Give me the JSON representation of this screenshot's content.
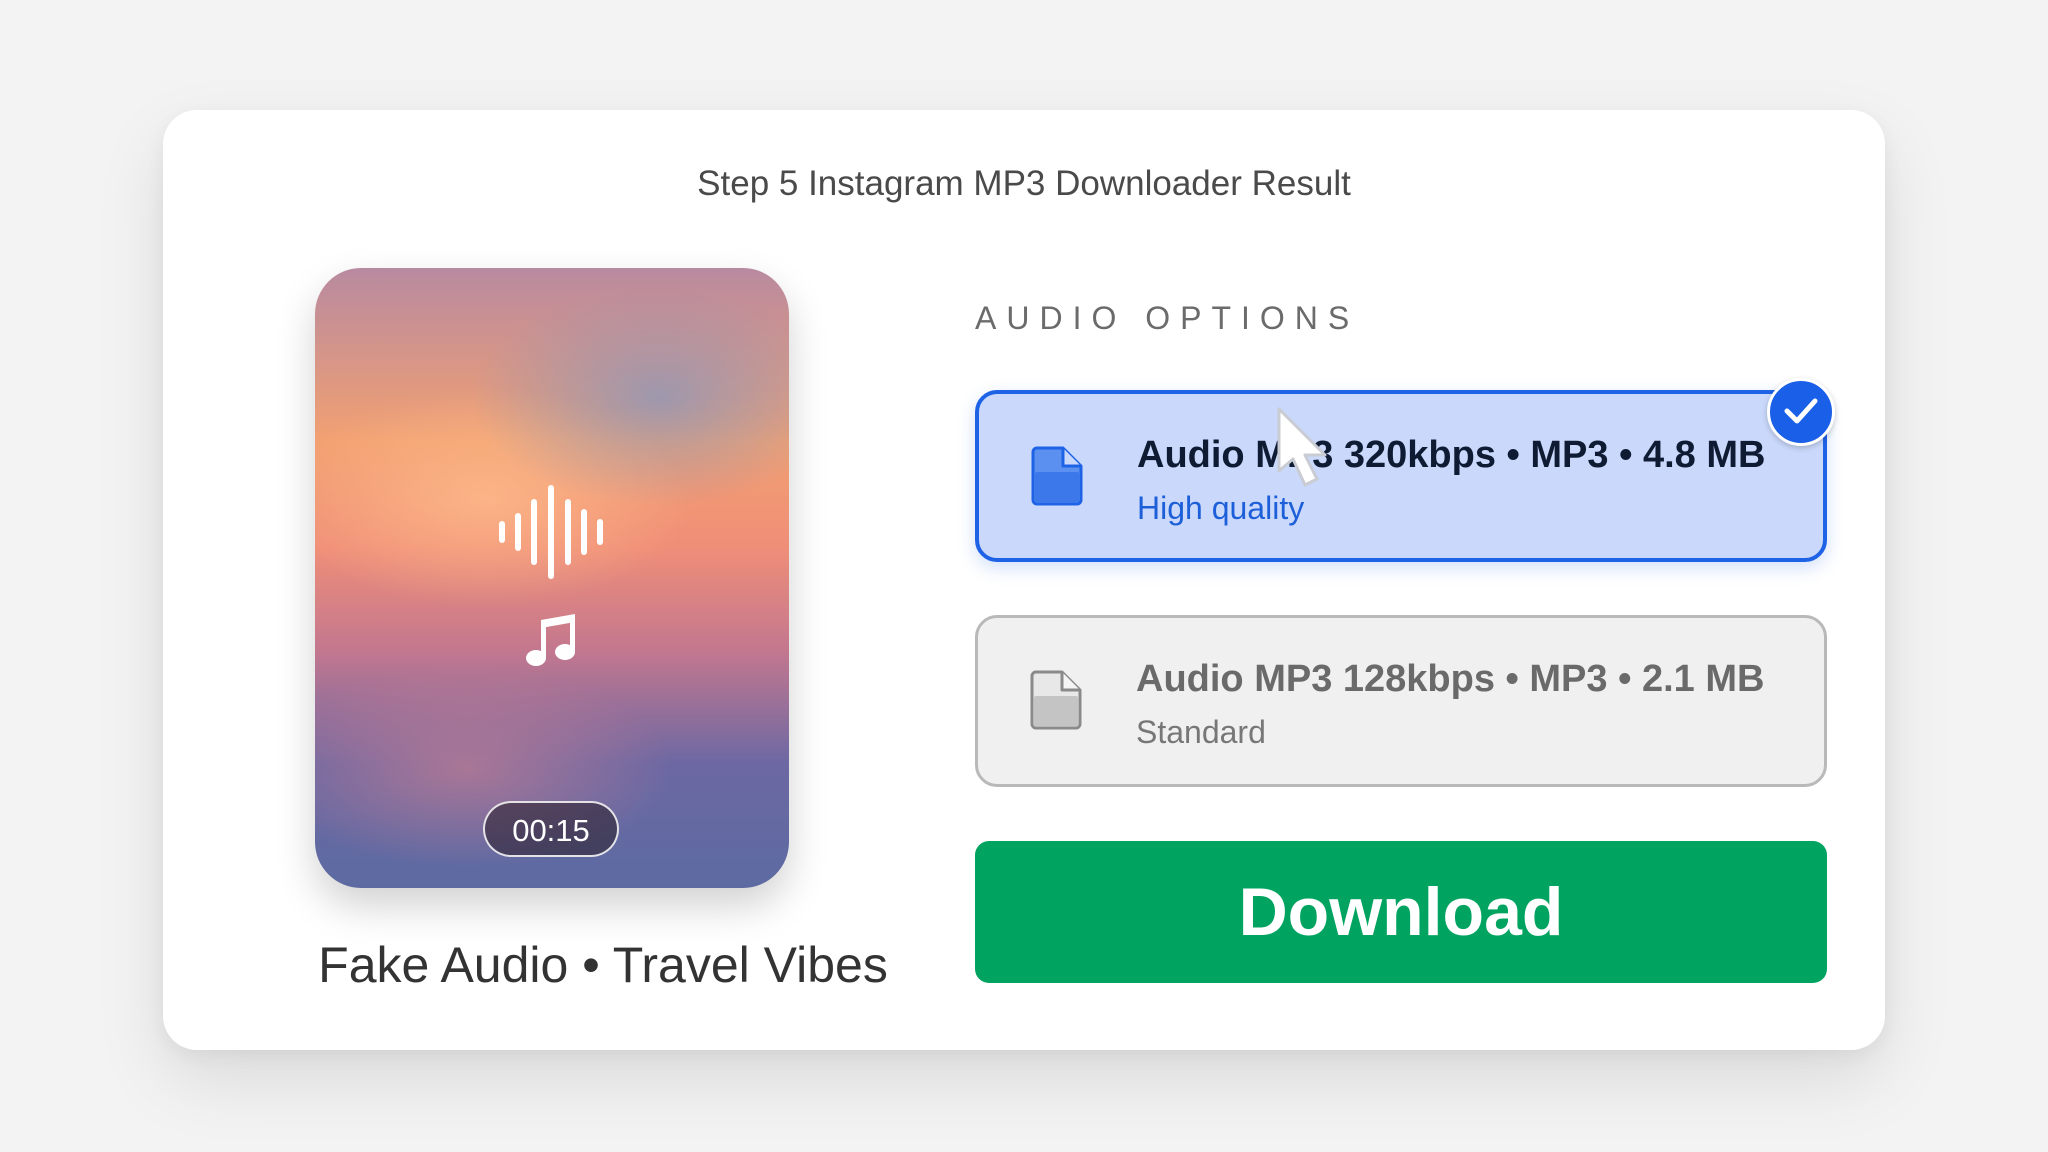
{
  "header": {
    "title": "Step 5 Instagram MP3 Downloader Result"
  },
  "preview": {
    "duration": "00:15",
    "audio_title": "Fake Audio • Travel Vibes",
    "icons": [
      "sound-wave-icon",
      "music-note-icon"
    ]
  },
  "options_section": {
    "label": "AUDIO OPTIONS",
    "options": [
      {
        "title": "Audio MP3 320kbps • MP3 • 4.8 MB",
        "subtitle": "High quality",
        "selected": true,
        "icon": "file-icon"
      },
      {
        "title": "Audio MP3 128kbps • MP3 • 2.1 MB",
        "subtitle": "Standard",
        "selected": false,
        "icon": "file-icon"
      }
    ]
  },
  "actions": {
    "download_label": "Download"
  },
  "colors": {
    "selected_bg": "#c9d8fb",
    "selected_border": "#1e63e6",
    "download_bg": "#00a360",
    "check_bg": "#1a5fe8"
  }
}
